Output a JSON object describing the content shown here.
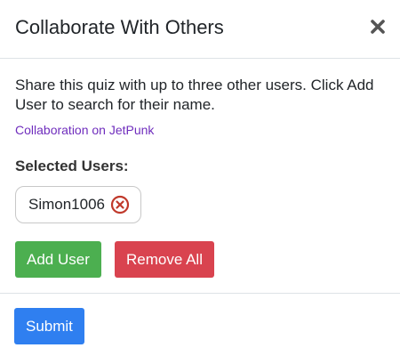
{
  "modal": {
    "title": "Collaborate With Others",
    "close_icon": "close-icon"
  },
  "body": {
    "description": "Share this quiz with up to three other users. Click Add User to search for their name.",
    "link_text": "Collaboration on JetPunk",
    "selected_heading": "Selected Users:",
    "selected_users": [
      {
        "name": "Simon1006",
        "remove_icon": "remove-circle-icon"
      }
    ],
    "add_user_label": "Add User",
    "remove_all_label": "Remove All"
  },
  "footer": {
    "submit_label": "Submit"
  },
  "colors": {
    "link": "#6f2dbd",
    "add_button": "#4caf50",
    "remove_button": "#d9434f",
    "submit_button": "#2f7ff0",
    "remove_icon": "#c0392b"
  }
}
